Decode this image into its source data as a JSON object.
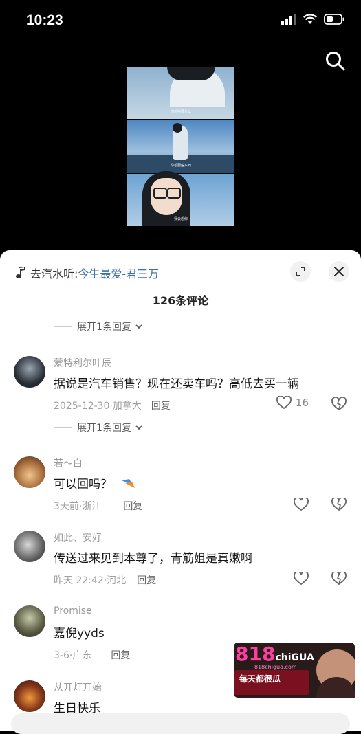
{
  "status": {
    "time": "10:23"
  },
  "video": {
    "captions": [
      "你想吗要什么",
      "你想要些东西",
      "我会想你"
    ]
  },
  "sheet": {
    "music_prefix": "去汽水听:",
    "music_title": "今生最爱-君三万",
    "title": "126条评论",
    "expand_label": "展开1条回复"
  },
  "comments": [
    {
      "user": "蒙特利尔叶辰",
      "text": "据说是汽车销售？现在还卖车吗？高低去买一辆",
      "meta": "2025-12-30·加拿大",
      "reply": "回复",
      "likes": "16"
    },
    {
      "user": "若～白",
      "text": "可以回吗？",
      "meta": "3天前·浙江",
      "reply": "回复",
      "likes": ""
    },
    {
      "user": "如此、安好",
      "text": "传送过来见到本尊了，青筋姐是真嫩啊",
      "meta": "昨天 22:42·河北",
      "reply": "回复",
      "likes": ""
    },
    {
      "user": "Promise",
      "text": "嘉倪yyds",
      "meta": "3-6·广东",
      "reply": "回复",
      "likes": ""
    },
    {
      "user": "从开灯开始",
      "text": "生日快乐",
      "meta": "",
      "reply": "",
      "likes": ""
    }
  ],
  "ad": {
    "brand": "818",
    "brand2": "chiGUA",
    "domain": "818chigua.com",
    "slogan": "每天都很瓜"
  },
  "colors": {
    "accent_link": "#3b6fa8",
    "muted": "#9a9a9a"
  }
}
